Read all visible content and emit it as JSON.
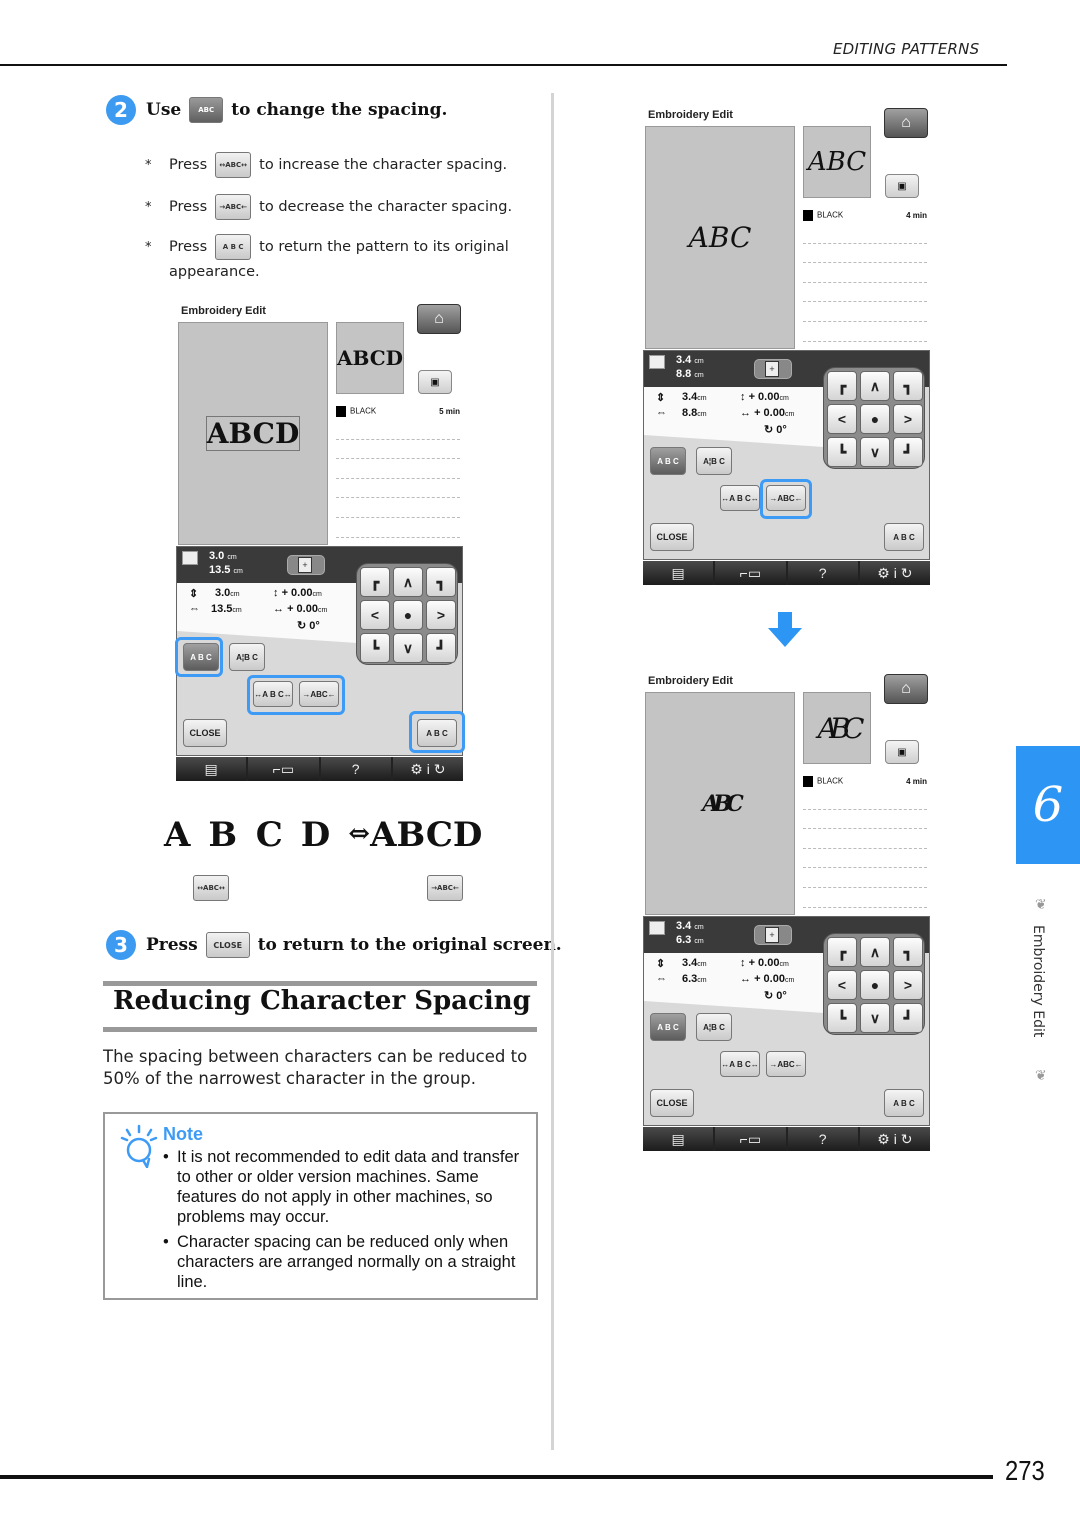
{
  "header": {
    "running_head": "EDITING PATTERNS"
  },
  "step2": {
    "number": "2",
    "before": "Use",
    "icon": "spacing-mode-icon",
    "after": "to change the spacing.",
    "bullets": [
      {
        "star": "*",
        "press": "Press",
        "button": "↔ABC↔",
        "text": "to increase the character spacing."
      },
      {
        "star": "*",
        "press": "Press",
        "button": "→ABC←",
        "text": "to decrease the character spacing."
      },
      {
        "star": "*",
        "press": "Press",
        "button": "A B C",
        "text": "to return the pattern to its original",
        "continuation": "appearance."
      }
    ]
  },
  "screens": [
    {
      "title": "Embroidery Edit",
      "canvas_text": "ABCD",
      "preview_text": "ABCD",
      "thread_color": "BLACK",
      "time": "5 min",
      "top_height": "3.0",
      "top_width": "13.5",
      "unit": "cm",
      "height": "3.0",
      "width": "13.5",
      "v_offset": "+ 0.00",
      "h_offset": "+ 0.00",
      "rotation": "0°",
      "tab_spacing": "A B C",
      "tab_array": "A¦B C",
      "btn_increase": "↔A B C↔",
      "btn_decrease": "→ABC←",
      "close": "CLOSE",
      "reset": "A B C"
    },
    {
      "title": "Embroidery Edit",
      "canvas_text": "ABC",
      "preview_text": "ABC",
      "thread_color": "BLACK",
      "time": "4 min",
      "top_height": "3.4",
      "top_width": "8.8",
      "unit": "cm",
      "height": "3.4",
      "width": "8.8",
      "v_offset": "+ 0.00",
      "h_offset": "+ 0.00",
      "rotation": "0°",
      "tab_spacing": "A B C",
      "tab_array": "A¦B C",
      "btn_increase": "↔A B C↔",
      "btn_decrease": "→ABC←",
      "close": "CLOSE",
      "reset": "A B C"
    },
    {
      "title": "Embroidery Edit",
      "canvas_text": "ABC",
      "preview_text": "ABC",
      "thread_color": "BLACK",
      "time": "4 min",
      "top_height": "3.4",
      "top_width": "6.3",
      "unit": "cm",
      "height": "3.4",
      "width": "6.3",
      "v_offset": "+ 0.00",
      "h_offset": "+ 0.00",
      "rotation": "0°",
      "tab_spacing": "A B C",
      "tab_array": "A¦B C",
      "btn_increase": "↔A B C↔",
      "btn_decrease": "→ABC←",
      "close": "CLOSE",
      "reset": "A B C"
    }
  ],
  "compare": {
    "spaced": "ABCD",
    "arrow": "⇔",
    "tight": "ABCD",
    "btn_left": "↔ABC↔",
    "btn_right": "→ABC←"
  },
  "step3": {
    "number": "3",
    "before": "Press",
    "button": "CLOSE",
    "after": "to return to the original screen."
  },
  "section": {
    "title": "Reducing Character Spacing",
    "paragraph": "The spacing between characters can be reduced to 50% of the narrowest character in the group."
  },
  "note": {
    "title": "Note",
    "items": [
      "It is not recommended to edit data and transfer to other or older version machines. Same features do not apply in other machines, so problems may occur.",
      "Character spacing can be reduced only when characters are arranged normally on a straight line."
    ]
  },
  "sidebar": {
    "chapter": "6",
    "label": "Embroidery Edit"
  },
  "footer": {
    "page_number": "273"
  },
  "colors": {
    "accent": "#3d9bf5",
    "chapter_tab": "#2d96f5"
  }
}
